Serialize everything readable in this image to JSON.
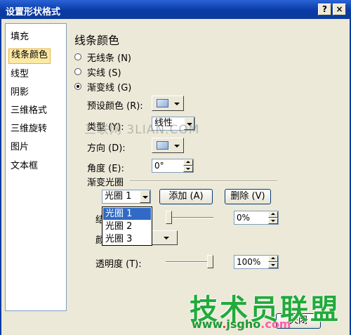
{
  "window": {
    "title": "设置形状格式",
    "help_glyph": "?",
    "close_glyph": "×"
  },
  "sidebar": {
    "items": [
      {
        "label": "填充"
      },
      {
        "label": "线条颜色",
        "selected": true
      },
      {
        "label": "线型"
      },
      {
        "label": "阴影"
      },
      {
        "label": "三维格式"
      },
      {
        "label": "三维旋转"
      },
      {
        "label": "图片"
      },
      {
        "label": "文本框"
      }
    ]
  },
  "main": {
    "section_title": "线条颜色",
    "radios": [
      {
        "label": "无线条 (N)",
        "checked": false
      },
      {
        "label": "实线 (S)",
        "checked": false
      },
      {
        "label": "渐变线 (G)",
        "checked": true
      }
    ],
    "preset_color_label": "预设颜色 (R):",
    "type_label": "类型 (Y):",
    "type_value": "线性",
    "direction_label": "方向 (D):",
    "angle_label": "角度 (E):",
    "angle_value": "0°",
    "gradient_stops_header": "渐变光圈",
    "stop_select_value": "光圈 1",
    "add_button": "添加 (A)",
    "delete_button": "删除 (V)",
    "stop_options": [
      "光圈 1",
      "光圈 2",
      "光圈 3"
    ],
    "stop_position_label_partial": "结",
    "stop_position_value": "0%",
    "color_label_partial": "颜",
    "transparency_label": "透明度 (T):",
    "transparency_value": "100%"
  },
  "footer": {
    "close_button_partial": "关闭"
  },
  "watermarks": {
    "middle": "三联网 3LIAN.COM",
    "logo": "技术员联盟",
    "url_main": "www",
    "url_dot": ".",
    "url_domain": "jsgho",
    "url_tld": ".com"
  }
}
